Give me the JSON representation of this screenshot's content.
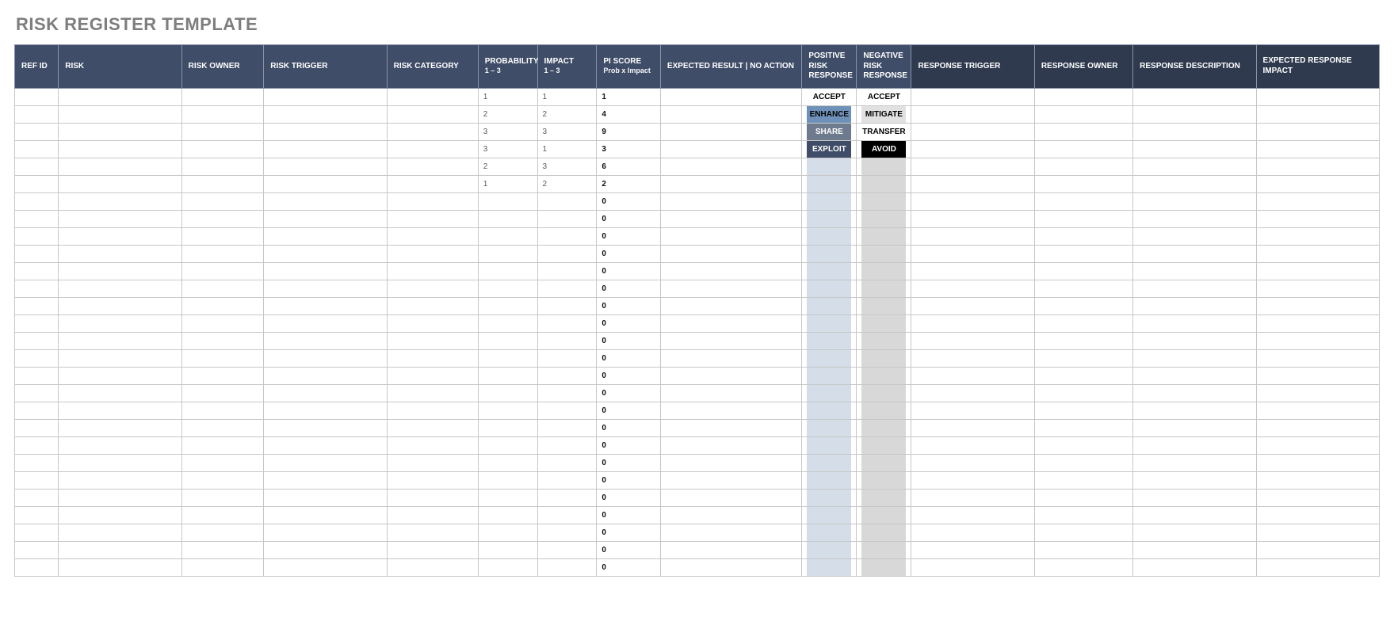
{
  "title": "RISK REGISTER TEMPLATE",
  "headers": {
    "ref": "REF ID",
    "risk": "RISK",
    "owner": "RISK OWNER",
    "trigger": "RISK TRIGGER",
    "category": "RISK CATEGORY",
    "prob": "PROBABILITY",
    "prob_sub": "1 – 3",
    "impact": "IMPACT",
    "impact_sub": "1 – 3",
    "pi": "PI SCORE",
    "pi_sub": "Prob x Impact",
    "expected": "EXPECTED RESULT | NO ACTION",
    "posr": "POSITIVE RISK RESPONSE",
    "negr": "NEGATIVE RISK RESPONSE",
    "rtrig": "RESPONSE TRIGGER",
    "rowner": "RESPONSE OWNER",
    "rdesc": "RESPONSE DESCRIPTION",
    "rimp": "EXPECTED RESPONSE IMPACT"
  },
  "rows": [
    {
      "prob": 1,
      "impact": 1,
      "pi": 1,
      "pos": "ACCEPT",
      "neg": "ACCEPT"
    },
    {
      "prob": 2,
      "impact": 2,
      "pi": 4,
      "pos": "ENHANCE",
      "neg": "MITIGATE"
    },
    {
      "prob": 3,
      "impact": 3,
      "pi": 9,
      "pos": "SHARE",
      "neg": "TRANSFER"
    },
    {
      "prob": 3,
      "impact": 1,
      "pi": 3,
      "pos": "EXPLOIT",
      "neg": "AVOID"
    },
    {
      "prob": 2,
      "impact": 3,
      "pi": 6,
      "pos": "",
      "neg": ""
    },
    {
      "prob": 1,
      "impact": 2,
      "pi": 2,
      "pos": "",
      "neg": ""
    },
    {
      "prob": "",
      "impact": "",
      "pi": 0,
      "pos": "",
      "neg": ""
    },
    {
      "prob": "",
      "impact": "",
      "pi": 0,
      "pos": "",
      "neg": ""
    },
    {
      "prob": "",
      "impact": "",
      "pi": 0,
      "pos": "",
      "neg": ""
    },
    {
      "prob": "",
      "impact": "",
      "pi": 0,
      "pos": "",
      "neg": ""
    },
    {
      "prob": "",
      "impact": "",
      "pi": 0,
      "pos": "",
      "neg": ""
    },
    {
      "prob": "",
      "impact": "",
      "pi": 0,
      "pos": "",
      "neg": ""
    },
    {
      "prob": "",
      "impact": "",
      "pi": 0,
      "pos": "",
      "neg": ""
    },
    {
      "prob": "",
      "impact": "",
      "pi": 0,
      "pos": "",
      "neg": ""
    },
    {
      "prob": "",
      "impact": "",
      "pi": 0,
      "pos": "",
      "neg": ""
    },
    {
      "prob": "",
      "impact": "",
      "pi": 0,
      "pos": "",
      "neg": ""
    },
    {
      "prob": "",
      "impact": "",
      "pi": 0,
      "pos": "",
      "neg": ""
    },
    {
      "prob": "",
      "impact": "",
      "pi": 0,
      "pos": "",
      "neg": ""
    },
    {
      "prob": "",
      "impact": "",
      "pi": 0,
      "pos": "",
      "neg": ""
    },
    {
      "prob": "",
      "impact": "",
      "pi": 0,
      "pos": "",
      "neg": ""
    },
    {
      "prob": "",
      "impact": "",
      "pi": 0,
      "pos": "",
      "neg": ""
    },
    {
      "prob": "",
      "impact": "",
      "pi": 0,
      "pos": "",
      "neg": ""
    },
    {
      "prob": "",
      "impact": "",
      "pi": 0,
      "pos": "",
      "neg": ""
    },
    {
      "prob": "",
      "impact": "",
      "pi": 0,
      "pos": "",
      "neg": ""
    },
    {
      "prob": "",
      "impact": "",
      "pi": 0,
      "pos": "",
      "neg": ""
    },
    {
      "prob": "",
      "impact": "",
      "pi": 0,
      "pos": "",
      "neg": ""
    },
    {
      "prob": "",
      "impact": "",
      "pi": 0,
      "pos": "",
      "neg": ""
    },
    {
      "prob": "",
      "impact": "",
      "pi": 0,
      "pos": "",
      "neg": ""
    }
  ],
  "responseClassMap": {
    "pos": {
      "ACCEPT": "r-accept-p",
      "ENHANCE": "r-enhance",
      "SHARE": "r-share",
      "EXPLOIT": "r-exploit",
      "": "r-blank-p"
    },
    "neg": {
      "ACCEPT": "r-accept-n",
      "MITIGATE": "r-mitigate",
      "TRANSFER": "r-transfer",
      "AVOID": "r-avoid",
      "": "r-blank-n"
    }
  }
}
